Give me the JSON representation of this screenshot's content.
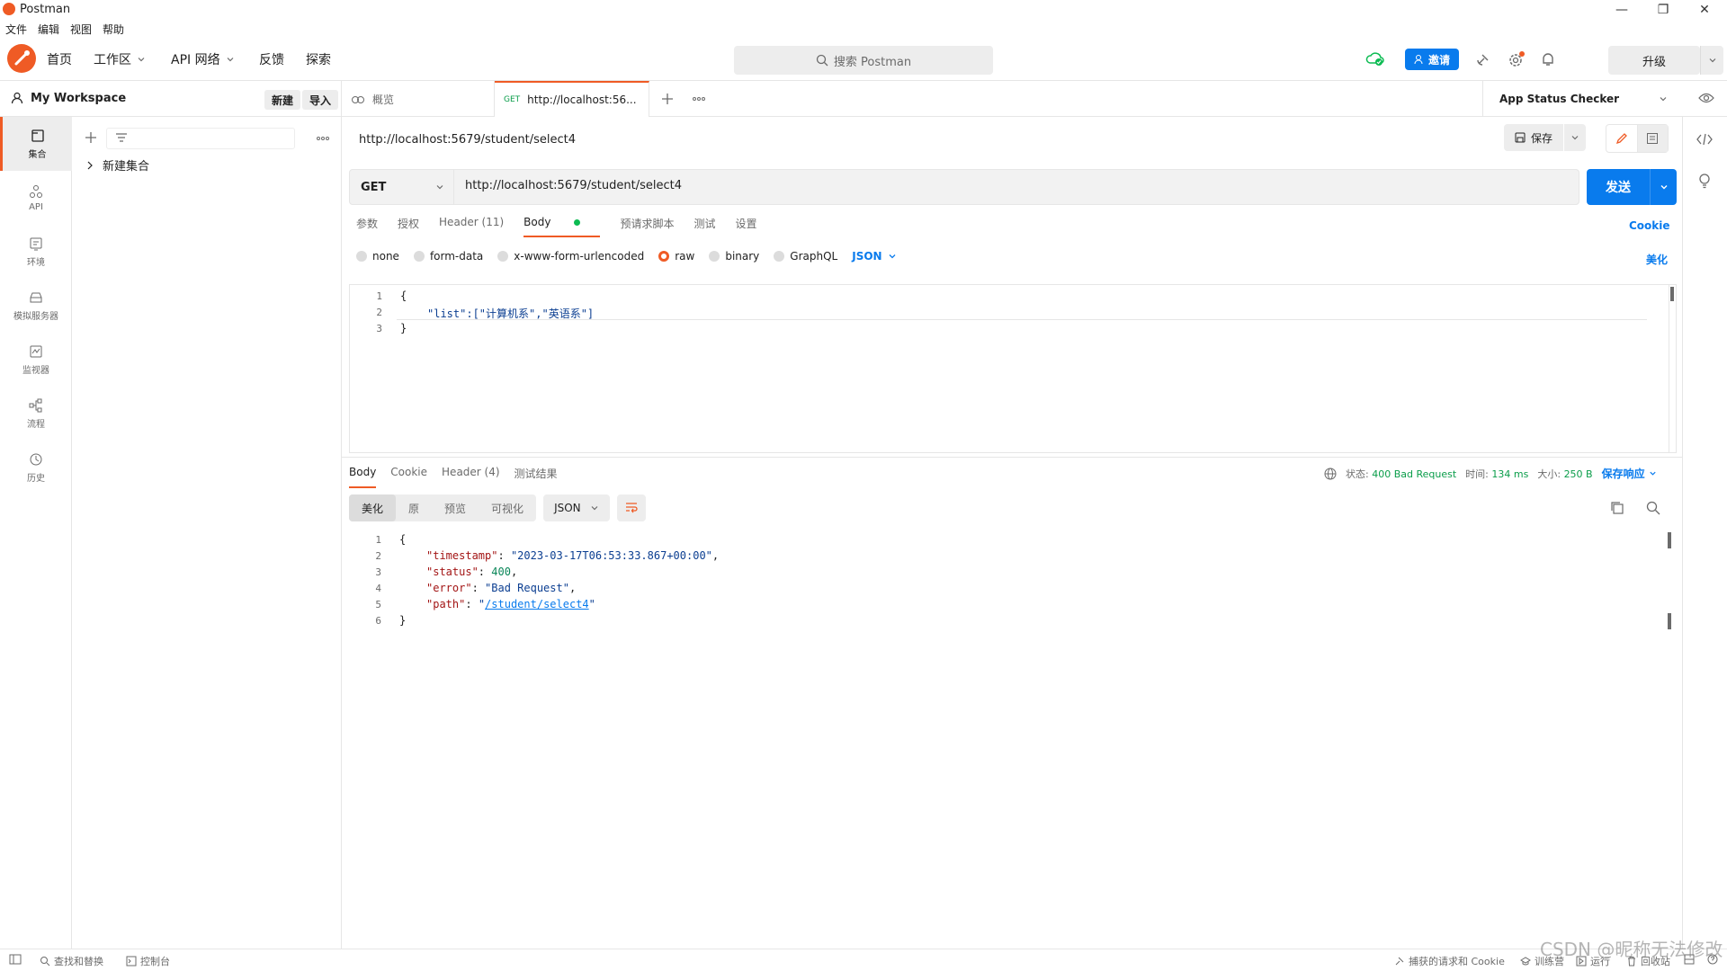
{
  "window": {
    "title": "Postman",
    "minimize": "—",
    "maximize": "❐",
    "close": "✕"
  },
  "menu": [
    "文件",
    "编辑",
    "视图",
    "帮助"
  ],
  "header": {
    "home": "首页",
    "workspaces": "工作区",
    "api_network": "API 网络",
    "feedback": "反馈",
    "explore": "探索",
    "search_placeholder": "搜索 Postman",
    "invite": "邀请",
    "upgrade": "升级"
  },
  "sidebar": {
    "workspace_name": "My Workspace",
    "new_label": "新建",
    "import_label": "导入",
    "rail": [
      {
        "label": "集合",
        "icon": "collections-icon"
      },
      {
        "label": "API",
        "icon": "api-icon"
      },
      {
        "label": "环境",
        "icon": "environments-icon"
      },
      {
        "label": "模拟服务器",
        "icon": "mock-servers-icon"
      },
      {
        "label": "监视器",
        "icon": "monitors-icon"
      },
      {
        "label": "流程",
        "icon": "flows-icon"
      },
      {
        "label": "历史",
        "icon": "history-icon"
      }
    ],
    "collection_item": "新建集合"
  },
  "tabs": {
    "overview": "概览",
    "active_method": "GET",
    "active_label": "http://localhost:56...",
    "environment": "App Status Checker"
  },
  "request": {
    "title": "http://localhost:5679/student/select4",
    "save": "保存",
    "method": "GET",
    "url": "http://localhost:5679/student/select4",
    "send": "发送",
    "tabs": [
      "参数",
      "授权",
      "Header (11)",
      "Body",
      "预请求脚本",
      "测试",
      "设置"
    ],
    "cookie_link": "Cookie",
    "body_types": [
      "none",
      "form-data",
      "x-www-form-urlencoded",
      "raw",
      "binary",
      "GraphQL"
    ],
    "format": "JSON",
    "beautify": "美化",
    "body_lines": [
      "{",
      "\"list\":[\"计算机系\",\"英语系\"]",
      "}"
    ],
    "line_numbers": [
      "1",
      "2",
      "3"
    ]
  },
  "response": {
    "tabs": [
      "Body",
      "Cookie",
      "Header (4)",
      "测试结果"
    ],
    "status_label": "状态:",
    "status_value": "400 Bad Request",
    "time_label": "时间:",
    "time_value": "134 ms",
    "size_label": "大小:",
    "size_value": "250 B",
    "save_response": "保存响应",
    "views": [
      "美化",
      "原",
      "预览",
      "可视化"
    ],
    "format": "JSON",
    "line_numbers": [
      "1",
      "2",
      "3",
      "4",
      "5",
      "6"
    ],
    "json": {
      "open": "{",
      "timestamp_key": "\"timestamp\"",
      "timestamp_val": "\"2023-03-17T06:53:33.867+00:00\"",
      "status_key": "\"status\"",
      "status_val": "400",
      "error_key": "\"error\"",
      "error_val": "\"Bad Request\"",
      "path_key": "\"path\"",
      "path_val": "/student/select4",
      "close": "}"
    }
  },
  "statusbar": {
    "find_replace": "查找和替换",
    "console": "控制台",
    "capture": "捕获的请求和 Cookie",
    "bootcamp": "训练营",
    "runner": "运行",
    "trash": "回收站"
  },
  "watermark": "CSDN @昵称无法修改",
  "colors": {
    "accent": "#ef5b25",
    "primary": "#097bed",
    "success": "#0cbb52"
  }
}
